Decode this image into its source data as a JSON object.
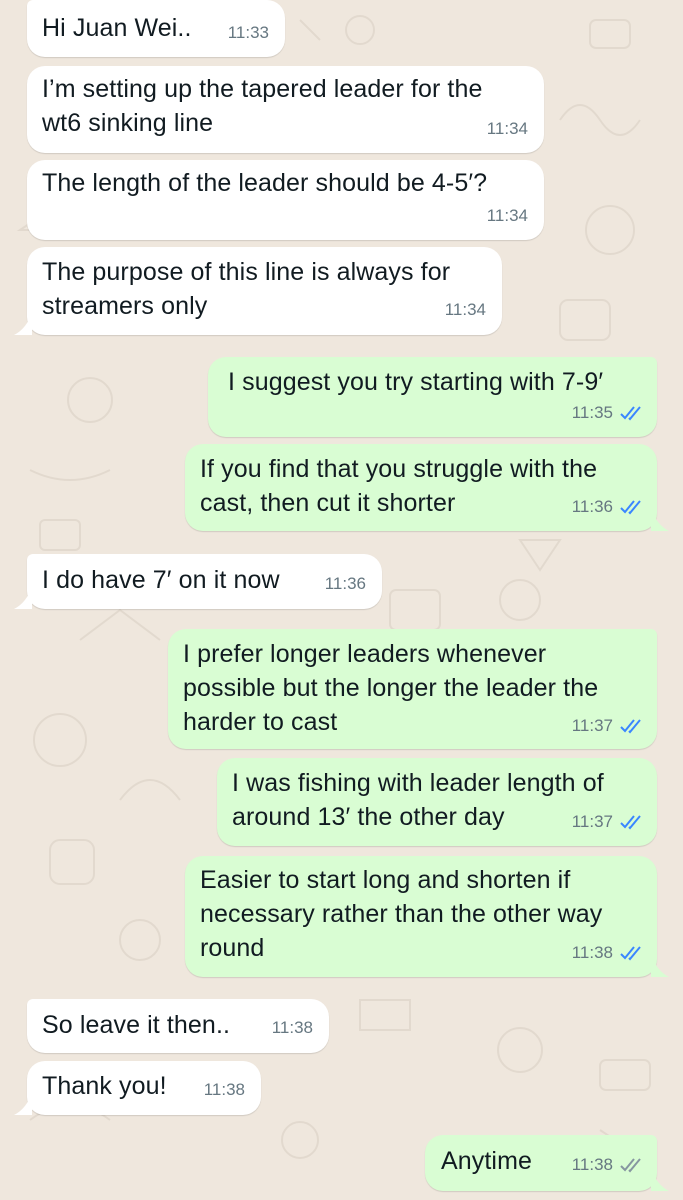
{
  "colors": {
    "incoming_bubble": "#ffffff",
    "outgoing_bubble": "#d9fdd3",
    "read_ticks": "#3a86ff",
    "delivered_ticks": "#8696a0",
    "wallpaper": "#efe7dd"
  },
  "messages": [
    {
      "direction": "incoming",
      "text": "Hi Juan Wei..",
      "time": "11:33"
    },
    {
      "direction": "incoming",
      "text": "I’m setting up the tapered leader for the\nwt6 sinking line",
      "time": "11:34"
    },
    {
      "direction": "incoming",
      "text": "The length of the leader should be 4-5′?",
      "time": "11:34"
    },
    {
      "direction": "incoming",
      "text": "The purpose of this line is always for\nstreamers only",
      "time": "11:34"
    },
    {
      "direction": "outgoing",
      "text": "I suggest you try starting with 7-9′",
      "time": "11:35",
      "status": "read",
      "status_icon": "double-check-icon"
    },
    {
      "direction": "outgoing",
      "text": "If you find that you struggle with the\ncast, then cut it shorter",
      "time": "11:36",
      "status": "read",
      "status_icon": "double-check-icon"
    },
    {
      "direction": "incoming",
      "text": "I do have 7′ on it now",
      "time": "11:36"
    },
    {
      "direction": "outgoing",
      "text": "I prefer longer leaders whenever\npossible but the longer the leader the\nharder to cast",
      "time": "11:37",
      "status": "read",
      "status_icon": "double-check-icon"
    },
    {
      "direction": "outgoing",
      "text": "I was fishing with leader length of\naround 13′ the other day",
      "time": "11:37",
      "status": "read",
      "status_icon": "double-check-icon"
    },
    {
      "direction": "outgoing",
      "text": "Easier to start long and shorten if\nnecessary rather than the other way\nround",
      "time": "11:38",
      "status": "read",
      "status_icon": "double-check-icon"
    },
    {
      "direction": "incoming",
      "text": "So leave it then..",
      "time": "11:38"
    },
    {
      "direction": "incoming",
      "text": "Thank you!",
      "time": "11:38"
    },
    {
      "direction": "outgoing",
      "text": "Anytime",
      "time": "11:38",
      "status": "delivered",
      "status_icon": "double-check-icon"
    }
  ]
}
